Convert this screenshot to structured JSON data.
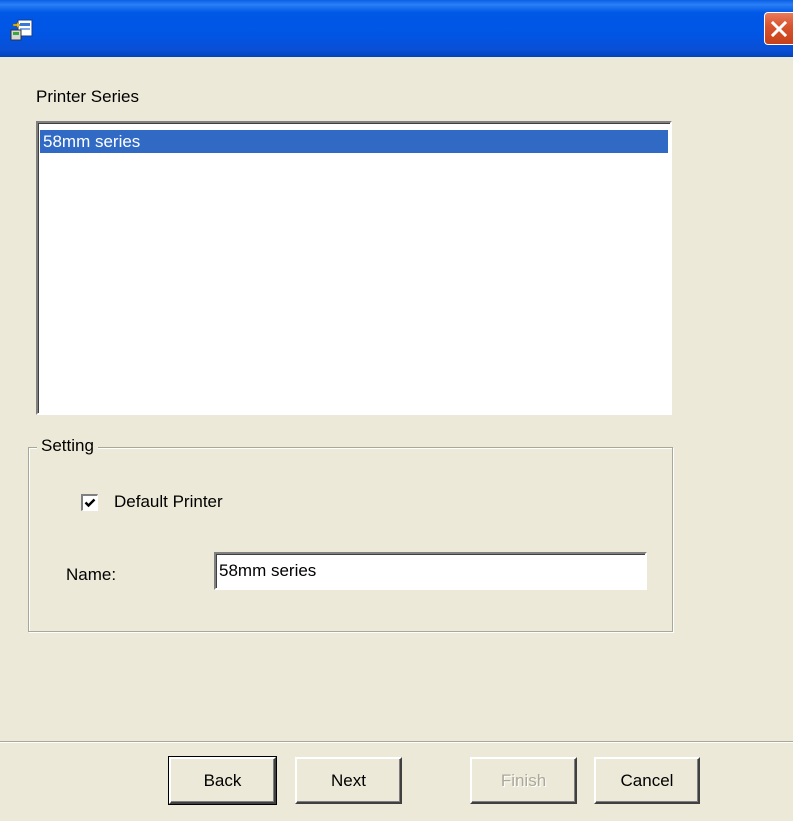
{
  "titlebar": {
    "icon": "setup-wizard-icon",
    "close": "close-icon"
  },
  "printer_series": {
    "label": "Printer Series",
    "items": [
      {
        "label": "58mm series",
        "selected": true
      }
    ]
  },
  "setting": {
    "legend": "Setting",
    "default_printer": {
      "label": "Default Printer",
      "checked": true
    },
    "name": {
      "label": "Name:",
      "value": "58mm series"
    }
  },
  "buttons": {
    "back": "Back",
    "next": "Next",
    "finish": "Finish",
    "cancel": "Cancel"
  },
  "colors": {
    "titlebar": "#0055E5",
    "selection": "#316AC5",
    "face": "#ECE9D8",
    "close": "#D9552F"
  }
}
